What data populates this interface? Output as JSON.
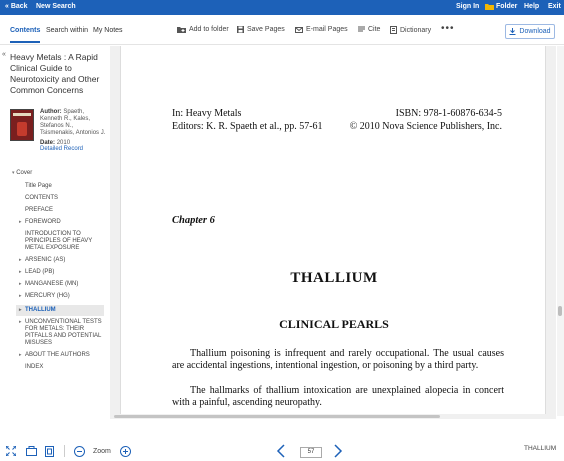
{
  "topbar": {
    "back": "« Back",
    "new_search": "New Search",
    "sign_in": "Sign In",
    "folder": "Folder",
    "help": "Help",
    "exit": "Exit"
  },
  "tabs": [
    {
      "label": "Contents",
      "active": true
    },
    {
      "label": "Search within",
      "active": false
    },
    {
      "label": "My Notes",
      "active": false
    }
  ],
  "tools": {
    "add_to_folder": "Add to folder",
    "save_pages": "Save Pages",
    "email_pages": "E-mail Pages",
    "cite": "Cite",
    "dictionary": "Dictionary",
    "more": "•••",
    "download": "Download"
  },
  "book": {
    "collapse": "«",
    "title": "Heavy Metals : A Rapid Clinical Guide to Neurotoxicity and Other Common Concerns",
    "author_label": "Author:",
    "authors": "Spaeth, Kenneth R., Kales, Stefanos N., Tsismenakis, Antonios J.",
    "date_label": "Date:",
    "date": "2010",
    "detailed_record": "Detailed Record"
  },
  "toc": {
    "cover": "Cover",
    "items": [
      {
        "label": "Title Page",
        "caret": false,
        "active": false
      },
      {
        "label": "CONTENTS",
        "caret": false,
        "active": false
      },
      {
        "label": "PREFACE",
        "caret": false,
        "active": false
      },
      {
        "label": "FOREWORD",
        "caret": true,
        "active": false
      },
      {
        "label": "INTRODUCTION TO PRINCIPLES OF HEAVY METAL EXPOSURE",
        "caret": false,
        "active": false
      },
      {
        "label": "ARSENIC (AS)",
        "caret": true,
        "active": false
      },
      {
        "label": "LEAD (PB)",
        "caret": true,
        "active": false
      },
      {
        "label": "MANGANESE (MN)",
        "caret": true,
        "active": false
      },
      {
        "label": "MERCURY (HG)",
        "caret": true,
        "active": false
      },
      {
        "label": "THALLIUM",
        "caret": true,
        "active": true
      },
      {
        "label": "UNCONVENTIONAL TESTS FOR METALS: THEIR PITFALLS AND POTENTIAL MISUSES",
        "caret": true,
        "active": false
      },
      {
        "label": "ABOUT THE AUTHORS",
        "caret": true,
        "active": false
      },
      {
        "label": "INDEX",
        "caret": false,
        "active": false
      }
    ]
  },
  "document": {
    "header_left_1": "In: Heavy Metals",
    "header_right_1": "ISBN: 978-1-60876-634-5",
    "header_left_2": "Editors: K. R. Spaeth et al., pp. 57-61",
    "header_right_2": "© 2010 Nova Science Publishers, Inc.",
    "chapter": "Chapter 6",
    "title": "THALLIUM",
    "section": "CLINICAL PEARLS",
    "para1": "Thallium poisoning is infrequent and rarely occupational. The usual causes are accidental ingestions, intentional ingestion, or poisoning by a third party.",
    "para2": "The hallmarks of thallium intoxication are unexplained alopecia in concert with a painful, ascending neuropathy."
  },
  "bottombar": {
    "zoom_label": "Zoom",
    "page_number": "57",
    "current_section": "THALLIUM"
  },
  "colors": {
    "brand_blue": "#1d61b8",
    "folder_yellow": "#f2b705"
  }
}
